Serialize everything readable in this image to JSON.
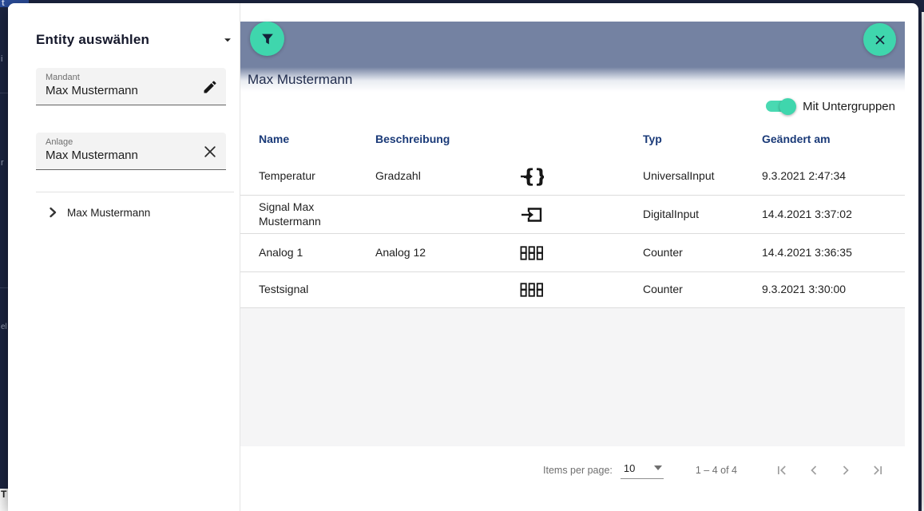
{
  "backdrop": {
    "fragments": [
      "t",
      "i",
      "r",
      "el",
      "T"
    ]
  },
  "sidebar": {
    "title": "Entity auswählen",
    "fields": [
      {
        "label": "Mandant",
        "value": "Max Mustermann",
        "icon": "edit-icon"
      },
      {
        "label": "Anlage",
        "value": "Max Mustermann",
        "icon": "clear-icon"
      }
    ],
    "tree_item": {
      "label": "Max Mustermann"
    }
  },
  "panel": {
    "title": "Max Mustermann",
    "toggle_label": "Mit Untergruppen",
    "toggle_on": true
  },
  "table": {
    "headers": [
      "Name",
      "Beschreibung",
      "Typ",
      "Geändert am"
    ],
    "rows": [
      {
        "name": "Temperatur",
        "description": "Gradzahl",
        "icon": "universal-input-icon",
        "typ": "UniversalInput",
        "changed": "9.3.2021 2:47:34"
      },
      {
        "name": "Signal Max Mustermann",
        "description": "",
        "icon": "digital-input-icon",
        "typ": "DigitalInput",
        "changed": "14.4.2021 3:37:02"
      },
      {
        "name": "Analog 1",
        "description": "Analog 12",
        "icon": "counter-icon",
        "typ": "Counter",
        "changed": "14.4.2021 3:36:35"
      },
      {
        "name": "Testsignal",
        "description": "",
        "icon": "counter-icon",
        "typ": "Counter",
        "changed": "9.3.2021 3:30:00"
      }
    ]
  },
  "paginator": {
    "items_per_page_label": "Items per page:",
    "page_size": "10",
    "range_label": "1 – 4 of 4"
  },
  "colors": {
    "accent_teal": "#3fd6ad",
    "header_bar": "#7482a2",
    "table_header_blue": "#1a3a78",
    "backdrop_navy": "#1c2541"
  }
}
